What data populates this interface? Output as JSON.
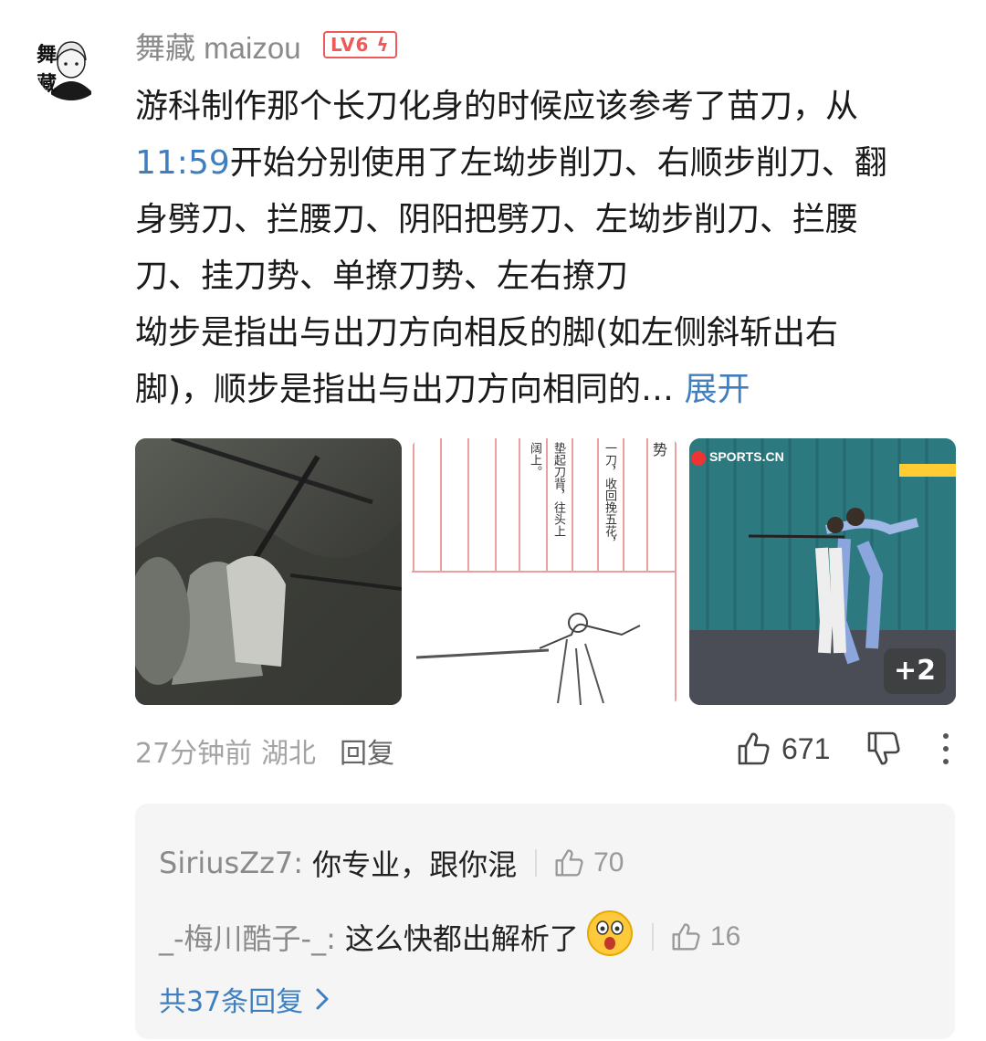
{
  "comment": {
    "username": "舞藏 maizou",
    "level": "LV6",
    "avatar_text": "舞 藏",
    "body_line1": "游科制作那个长刀化身的时候应该参考了苗刀，从",
    "timestamp": "11:59",
    "body_line2_rest": "开始分别使用了左坳步削刀、右顺步削刀、翻",
    "body_line3": "身劈刀、拦腰刀、阴阳把劈刀、左坳步削刀、拦腰",
    "body_line4": "刀、挂刀势、单撩刀势、左右撩刀",
    "body_line5": "坳步是指出与出刀方向相反的脚(如左侧斜斩出右",
    "body_line6": "脚)，顺步是指出与出刀方向相同的…",
    "expand": "展开"
  },
  "images": {
    "thumb2_text_col1": "一刀，收回挽五花，",
    "thumb2_text_col2": "垫起刀背，往头上",
    "thumb2_text_col3": "阔上。",
    "thumb2_text_col4": "势",
    "thumb3_watermark": "SPORTS.CN",
    "more_count": "+2"
  },
  "meta": {
    "time": "27分钟前",
    "location": "湖北",
    "reply_label": "回复",
    "likes": "671"
  },
  "replies": {
    "items": [
      {
        "user": "SiriusZz7:",
        "text": "你专业，跟你混",
        "likes": "70"
      },
      {
        "user": "_-梅川酷子-_:",
        "text": "这么快都出解析了",
        "likes": "16"
      }
    ],
    "view_all": "共37条回复"
  },
  "colors": {
    "link": "#3f7fbf",
    "level_badge": "#ee5a5a",
    "muted": "#a3a3a3"
  }
}
